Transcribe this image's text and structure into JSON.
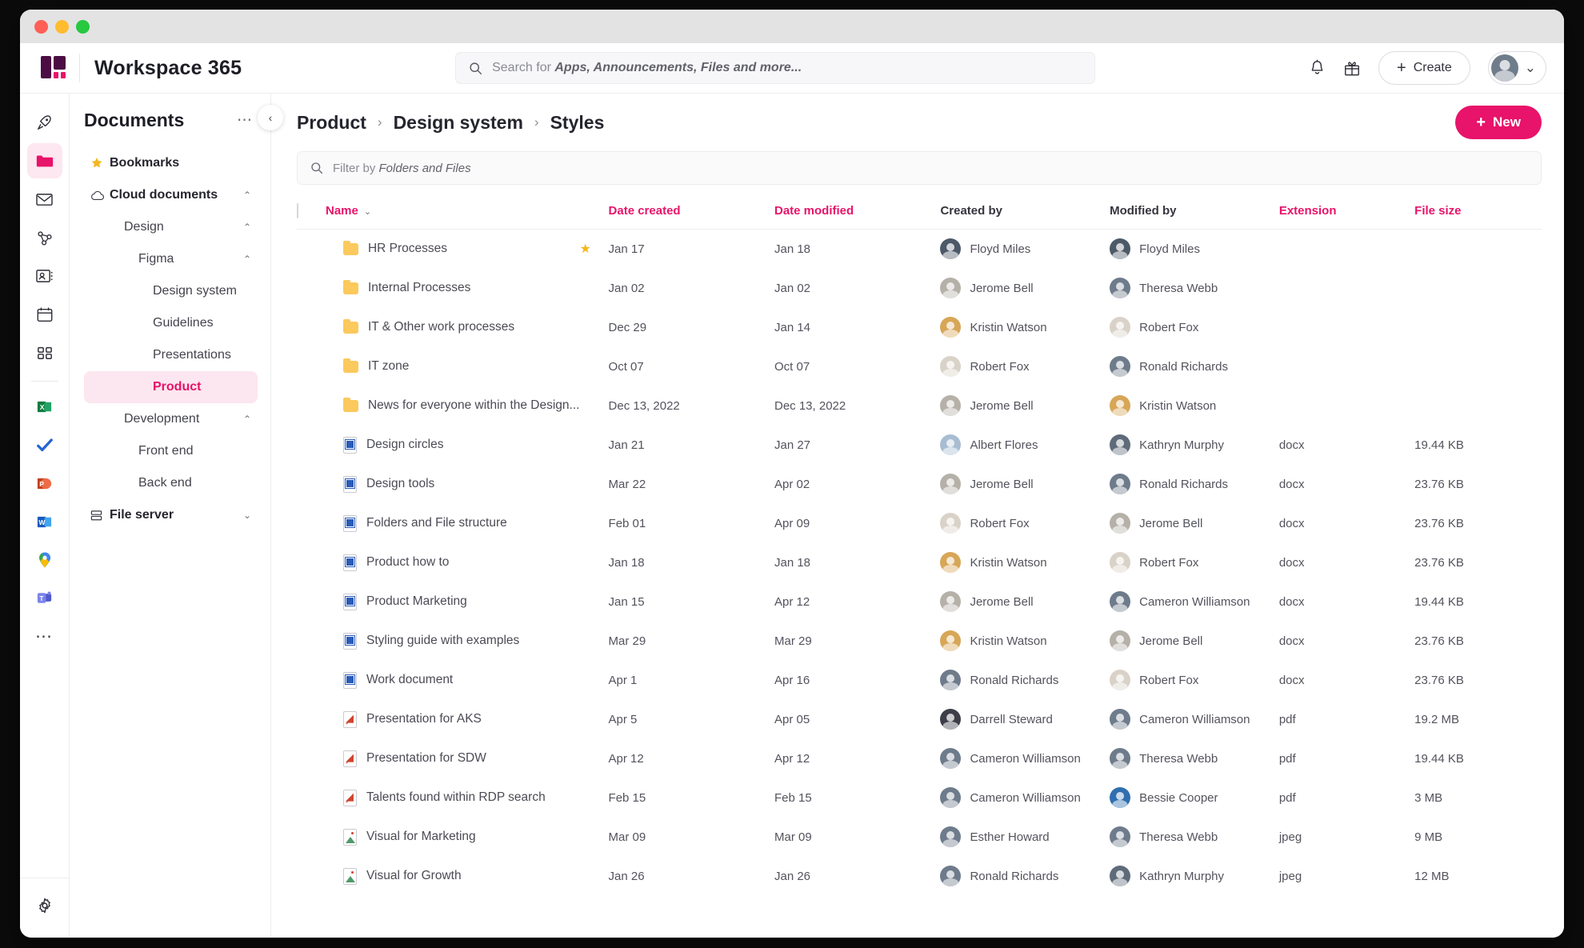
{
  "window": {
    "controls": [
      "close",
      "minimize",
      "maximize"
    ]
  },
  "header": {
    "brand": "Workspace 365",
    "search": {
      "prefix": "Search for ",
      "emphasis": "Apps, Announcements, Files and more..."
    },
    "notifications_icon": "bell-icon",
    "gift_icon": "gift-icon",
    "create_label": "Create",
    "create_plus": "+",
    "avatar_caret": "⌄"
  },
  "rail": {
    "items": [
      {
        "name": "rocket",
        "glyph": "rocket"
      },
      {
        "name": "documents",
        "glyph": "folder",
        "active": true
      },
      {
        "name": "mail",
        "glyph": "mail"
      },
      {
        "name": "share",
        "glyph": "share"
      },
      {
        "name": "contacts",
        "glyph": "contacts"
      },
      {
        "name": "calendar",
        "glyph": "calendar"
      },
      {
        "name": "apps",
        "glyph": "apps"
      },
      {
        "name": "excel",
        "glyph": "excel"
      },
      {
        "name": "todo",
        "glyph": "todo"
      },
      {
        "name": "powerpoint",
        "glyph": "powerpoint"
      },
      {
        "name": "word",
        "glyph": "word"
      },
      {
        "name": "maps",
        "glyph": "maps"
      },
      {
        "name": "teams",
        "glyph": "teams"
      },
      {
        "name": "more",
        "glyph": "more"
      }
    ],
    "settings": "gear-icon"
  },
  "nav": {
    "title": "Documents",
    "menu_dots": "⋯",
    "collapse": "‹",
    "items": [
      {
        "label": "Bookmarks",
        "icon": "star-icon",
        "indent": 0,
        "chevron": "",
        "bold": true,
        "selected": false
      },
      {
        "label": "Cloud documents",
        "icon": "cloud-icon",
        "indent": 0,
        "chevron": "⌃",
        "bold": true,
        "selected": false
      },
      {
        "label": "Design",
        "icon": "",
        "indent": 1,
        "chevron": "⌃",
        "bold": false,
        "selected": false
      },
      {
        "label": "Figma",
        "icon": "",
        "indent": 2,
        "chevron": "⌃",
        "bold": false,
        "selected": false
      },
      {
        "label": "Design system",
        "icon": "",
        "indent": 3,
        "chevron": "",
        "bold": false,
        "selected": false
      },
      {
        "label": "Guidelines",
        "icon": "",
        "indent": 3,
        "chevron": "",
        "bold": false,
        "selected": false
      },
      {
        "label": "Presentations",
        "icon": "",
        "indent": 3,
        "chevron": "",
        "bold": false,
        "selected": false
      },
      {
        "label": "Product",
        "icon": "",
        "indent": 3,
        "chevron": "",
        "bold": false,
        "selected": true
      },
      {
        "label": "Development",
        "icon": "",
        "indent": 1,
        "chevron": "⌃",
        "bold": false,
        "selected": false
      },
      {
        "label": "Front end",
        "icon": "",
        "indent": 2,
        "chevron": "",
        "bold": false,
        "selected": false
      },
      {
        "label": "Back end",
        "icon": "",
        "indent": 2,
        "chevron": "",
        "bold": false,
        "selected": false
      },
      {
        "label": "File server",
        "icon": "server-icon",
        "indent": 0,
        "chevron": "⌄",
        "bold": true,
        "selected": false
      }
    ]
  },
  "main": {
    "breadcrumbs": [
      "Product",
      "Design system",
      "Styles"
    ],
    "breadcrumb_sep": "›",
    "new_label": "New",
    "new_plus": "+",
    "filter": {
      "prefix": "Filter by ",
      "emphasis": "Folders and Files"
    },
    "columns": [
      {
        "label": "Name",
        "accent": true,
        "caret": "⌄"
      },
      {
        "label": "Date created",
        "accent": true
      },
      {
        "label": "Date modified",
        "accent": true
      },
      {
        "label": "Created by",
        "accent": false
      },
      {
        "label": "Modified by",
        "accent": false
      },
      {
        "label": "Extension",
        "accent": true
      },
      {
        "label": "File size",
        "accent": true
      }
    ],
    "rows": [
      {
        "type": "folder",
        "name": "HR Processes",
        "starred": true,
        "date_created": "Jan 17",
        "date_modified": "Jan 18",
        "created_by": "Floyd Miles",
        "modified_by": "Floyd Miles",
        "extension": "",
        "size": ""
      },
      {
        "type": "folder",
        "name": "Internal Processes",
        "starred": false,
        "date_created": "Jan 02",
        "date_modified": "Jan 02",
        "created_by": "Jerome Bell",
        "modified_by": "Theresa Webb",
        "extension": "",
        "size": ""
      },
      {
        "type": "folder",
        "name": "IT & Other work processes",
        "starred": false,
        "date_created": "Dec 29",
        "date_modified": "Jan 14",
        "created_by": "Kristin Watson",
        "modified_by": "Robert Fox",
        "extension": "",
        "size": ""
      },
      {
        "type": "folder",
        "name": "IT zone",
        "starred": false,
        "date_created": "Oct 07",
        "date_modified": "Oct 07",
        "created_by": "Robert Fox",
        "modified_by": "Ronald Richards",
        "extension": "",
        "size": ""
      },
      {
        "type": "folder",
        "name": "News for everyone within the Design...",
        "starred": false,
        "date_created": "Dec 13, 2022",
        "date_modified": "Dec 13, 2022",
        "created_by": "Jerome Bell",
        "modified_by": "Kristin Watson",
        "extension": "",
        "size": ""
      },
      {
        "type": "doc",
        "name": "Design circles",
        "starred": false,
        "date_created": "Jan 21",
        "date_modified": "Jan 27",
        "created_by": "Albert Flores",
        "modified_by": "Kathryn Murphy",
        "extension": "docx",
        "size": "19.44 KB"
      },
      {
        "type": "doc",
        "name": "Design tools",
        "starred": false,
        "date_created": "Mar 22",
        "date_modified": "Apr 02",
        "created_by": "Jerome Bell",
        "modified_by": "Ronald Richards",
        "extension": "docx",
        "size": "23.76 KB"
      },
      {
        "type": "doc",
        "name": "Folders and File structure",
        "starred": false,
        "date_created": "Feb 01",
        "date_modified": "Apr 09",
        "created_by": "Robert Fox",
        "modified_by": "Jerome Bell",
        "extension": "docx",
        "size": "23.76 KB"
      },
      {
        "type": "doc",
        "name": "Product how to",
        "starred": false,
        "date_created": "Jan 18",
        "date_modified": "Jan 18",
        "created_by": "Kristin Watson",
        "modified_by": "Robert Fox",
        "extension": "docx",
        "size": "23.76 KB"
      },
      {
        "type": "doc",
        "name": "Product Marketing",
        "starred": false,
        "date_created": "Jan 15",
        "date_modified": "Apr 12",
        "created_by": "Jerome Bell",
        "modified_by": "Cameron Williamson",
        "extension": "docx",
        "size": "19.44 KB"
      },
      {
        "type": "doc",
        "name": "Styling guide with examples",
        "starred": false,
        "date_created": "Mar 29",
        "date_modified": "Mar 29",
        "created_by": "Kristin Watson",
        "modified_by": "Jerome Bell",
        "extension": "docx",
        "size": "23.76 KB"
      },
      {
        "type": "doc",
        "name": "Work document",
        "starred": false,
        "date_created": "Apr 1",
        "date_modified": "Apr 16",
        "created_by": "Ronald Richards",
        "modified_by": "Robert Fox",
        "extension": "docx",
        "size": "23.76 KB"
      },
      {
        "type": "pdf",
        "name": "Presentation for AKS",
        "starred": false,
        "date_created": "Apr 5",
        "date_modified": "Apr 05",
        "created_by": "Darrell Steward",
        "modified_by": "Cameron Williamson",
        "extension": "pdf",
        "size": "19.2 MB"
      },
      {
        "type": "pdf",
        "name": "Presentation for SDW",
        "starred": false,
        "date_created": "Apr 12",
        "date_modified": "Apr 12",
        "created_by": "Cameron Williamson",
        "modified_by": "Theresa Webb",
        "extension": "pdf",
        "size": "19.44 KB"
      },
      {
        "type": "pdf",
        "name": "Talents found within RDP search",
        "starred": false,
        "date_created": "Feb 15",
        "date_modified": "Feb 15",
        "created_by": "Cameron Williamson",
        "modified_by": "Bessie Cooper",
        "extension": "pdf",
        "size": "3 MB"
      },
      {
        "type": "img",
        "name": "Visual for Marketing",
        "starred": false,
        "date_created": "Mar 09",
        "date_modified": "Mar 09",
        "created_by": "Esther Howard",
        "modified_by": "Theresa Webb",
        "extension": "jpeg",
        "size": "9 MB"
      },
      {
        "type": "img",
        "name": "Visual for Growth",
        "starred": false,
        "date_created": "Jan 26",
        "date_modified": "Jan 26",
        "created_by": "Ronald Richards",
        "modified_by": "Kathryn Murphy",
        "extension": "jpeg",
        "size": "12 MB"
      }
    ]
  },
  "colors": {
    "accent": "#e8136a",
    "accent_soft": "#fce6ef",
    "folder": "#fbc95c",
    "star": "#f5b620",
    "text": "#53535d",
    "heading": "#25252e"
  }
}
